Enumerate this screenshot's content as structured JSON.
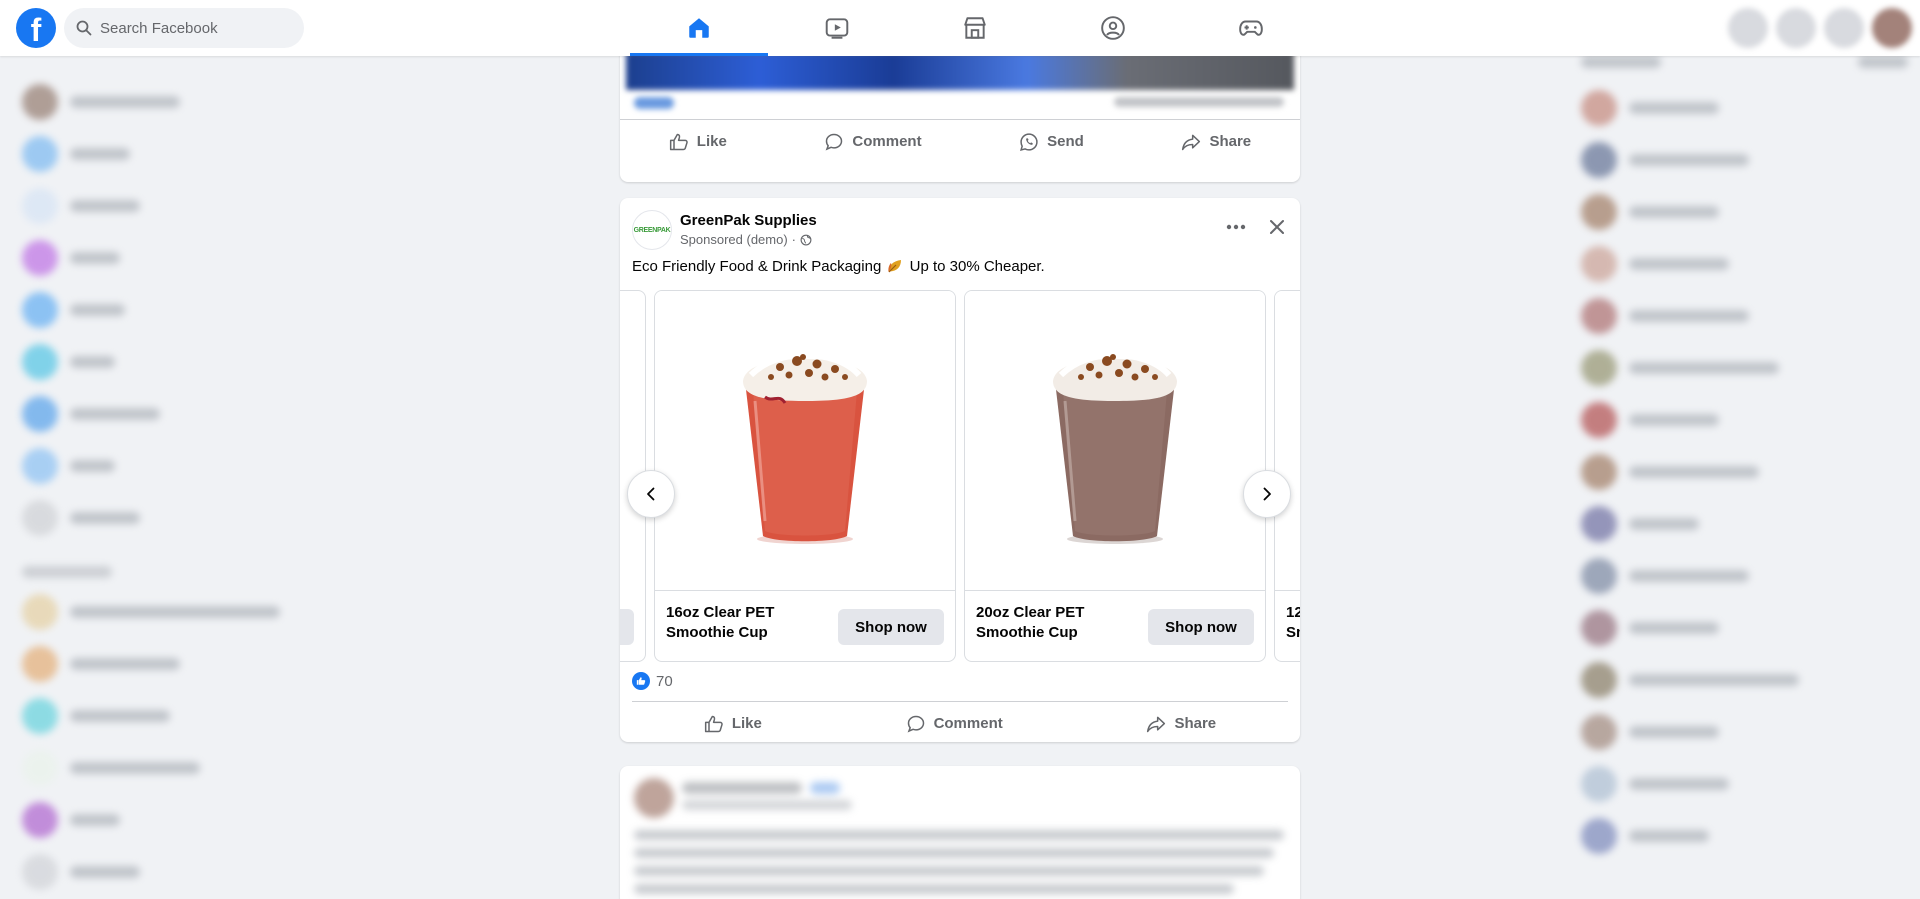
{
  "topbar": {
    "logo_letter": "f",
    "search_placeholder": "Search Facebook",
    "nav_items": [
      "home-icon",
      "video-icon",
      "marketplace-icon",
      "groups-icon",
      "gaming-icon"
    ],
    "active_nav": "home-icon",
    "accent_color": "#1877f2"
  },
  "previous_post": {
    "actions": {
      "like": "Like",
      "comment": "Comment",
      "send": "Send",
      "share": "Share"
    }
  },
  "ad_post": {
    "page_name": "GreenPak Supplies",
    "logo_text": "GREENPAK",
    "sponsored_label": "Sponsored (demo)",
    "separator": "·",
    "audience_icon": "globe-icon",
    "body_text_before": "Eco Friendly Food & Drink Packaging",
    "body_emoji": "leaf-icon",
    "body_text_after": "Up to 30% Cheaper.",
    "carousel": [
      {
        "title": "16oz Clear PET Smoothie Cup",
        "cta": "Shop now",
        "drink_color": "#d9533f"
      },
      {
        "title": "20oz Clear PET Smoothie Cup",
        "cta": "Shop now",
        "drink_color": "#8b6a62"
      },
      {
        "title": "12",
        "title_line2": "Sm"
      }
    ],
    "reaction_count": "70",
    "actions": {
      "like": "Like",
      "comment": "Comment",
      "share": "Share"
    }
  }
}
